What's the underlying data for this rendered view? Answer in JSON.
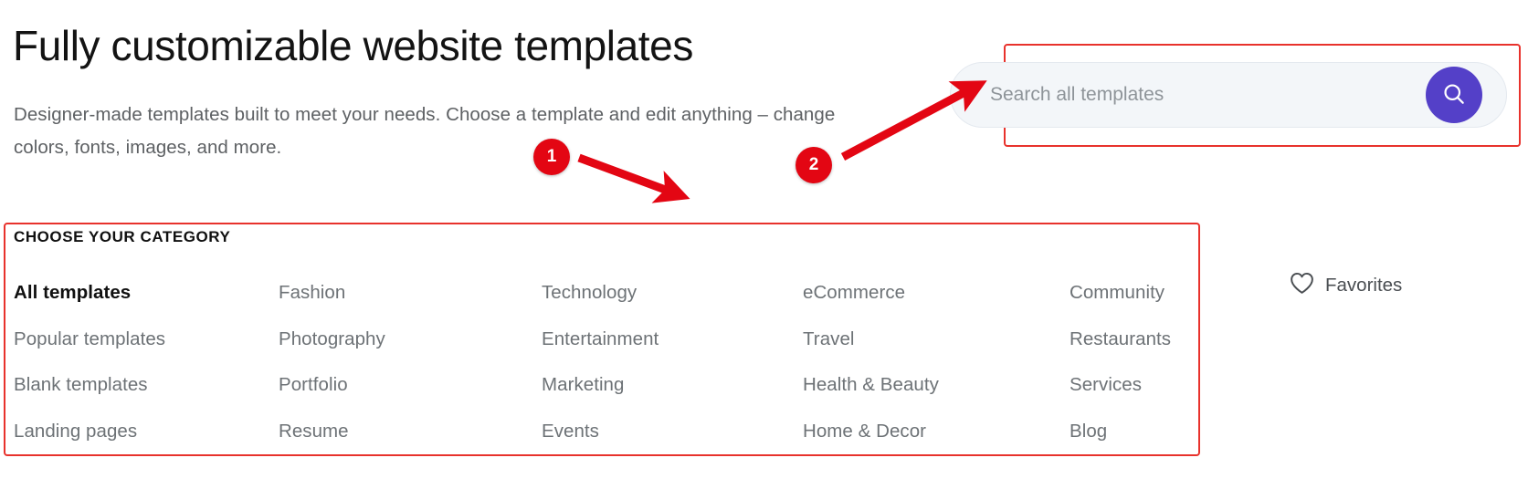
{
  "header": {
    "title": "Fully customizable website templates",
    "subtitle": "Designer-made templates built to meet your needs. Choose a template and edit anything – change colors, fonts, images, and more."
  },
  "search": {
    "placeholder": "Search all templates",
    "value": "",
    "submit_icon": "search-icon",
    "submit_color": "#5440c8"
  },
  "categories": {
    "heading": "CHOOSE YOUR CATEGORY",
    "columns": [
      {
        "items": [
          {
            "label": "All templates",
            "active": true
          },
          {
            "label": "Popular templates",
            "active": false
          },
          {
            "label": "Blank templates",
            "active": false
          },
          {
            "label": "Landing pages",
            "active": false
          }
        ]
      },
      {
        "items": [
          {
            "label": "Fashion",
            "active": false
          },
          {
            "label": "Photography",
            "active": false
          },
          {
            "label": "Portfolio",
            "active": false
          },
          {
            "label": "Resume",
            "active": false
          }
        ]
      },
      {
        "items": [
          {
            "label": "Technology",
            "active": false
          },
          {
            "label": "Entertainment",
            "active": false
          },
          {
            "label": "Marketing",
            "active": false
          },
          {
            "label": "Events",
            "active": false
          }
        ]
      },
      {
        "items": [
          {
            "label": "eCommerce",
            "active": false
          },
          {
            "label": "Travel",
            "active": false
          },
          {
            "label": "Health & Beauty",
            "active": false
          },
          {
            "label": "Home & Decor",
            "active": false
          }
        ]
      },
      {
        "items": [
          {
            "label": "Community",
            "active": false
          },
          {
            "label": "Restaurants",
            "active": false
          },
          {
            "label": "Services",
            "active": false
          },
          {
            "label": "Blog",
            "active": false
          }
        ]
      }
    ]
  },
  "favorites": {
    "label": "Favorites",
    "icon": "heart-outline-icon"
  },
  "annotations": {
    "highlight_color": "#e8322c",
    "marker_color": "#e30613",
    "markers": [
      {
        "number": "1"
      },
      {
        "number": "2"
      }
    ]
  }
}
